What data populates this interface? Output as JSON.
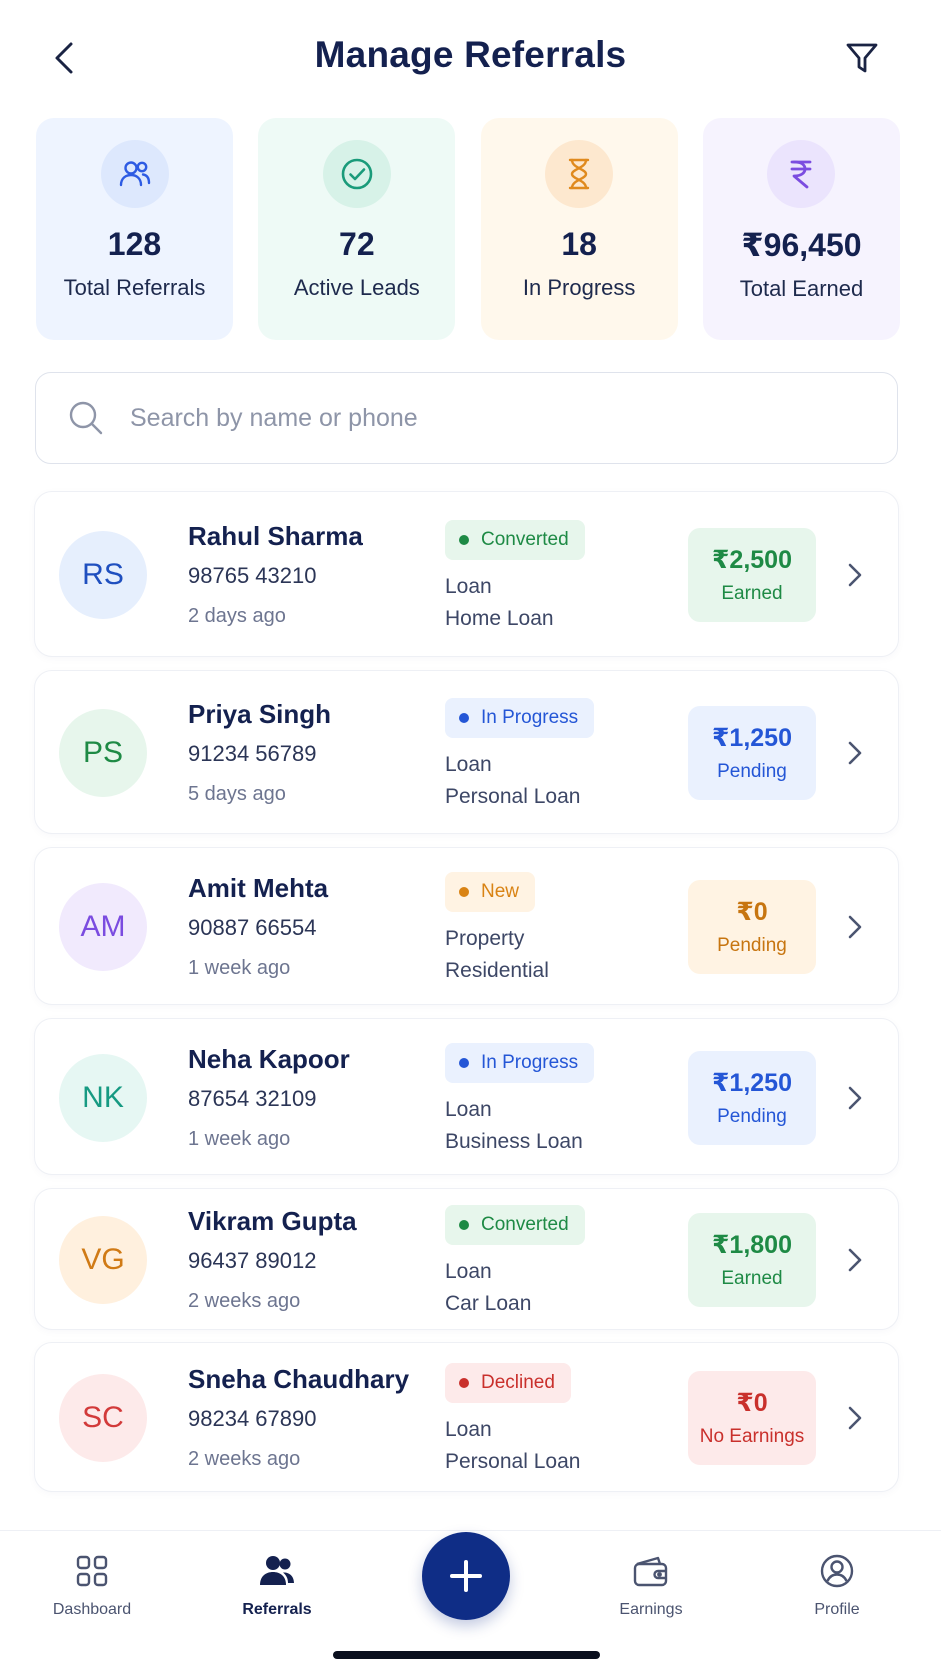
{
  "header": {
    "title": "Manage Referrals",
    "back_icon": "chevron-left-icon",
    "filter_icon": "filter-icon"
  },
  "stats": [
    {
      "value": "128",
      "label": "Total Referrals",
      "icon": "users-icon",
      "bg": "#eef4ff",
      "icon_bg": "#dde8fd",
      "icon_color": "#2d5be3"
    },
    {
      "value": "72",
      "label": "Active Leads",
      "icon": "check-circle-icon",
      "bg": "#eefaf6",
      "icon_bg": "#d7f2e8",
      "icon_color": "#1a9b7a"
    },
    {
      "value": "18",
      "label": "In Progress",
      "icon": "hourglass-icon",
      "bg": "#fff8ec",
      "icon_bg": "#fde8cf",
      "icon_color": "#e08a1e"
    },
    {
      "value": "₹96,450",
      "label": "Total Earned",
      "icon": "rupee-icon",
      "bg": "#f6f3fe",
      "icon_bg": "#ebe4fd",
      "icon_color": "#7b4ce0"
    }
  ],
  "search": {
    "placeholder": "Search by name or phone",
    "value": ""
  },
  "referrals": [
    {
      "initials": "RS",
      "name": "Rahul Sharma",
      "phone": "98765 43210",
      "time": "2 days ago",
      "status": "Converted",
      "category": "Loan",
      "subcategory": "Home Loan",
      "amount": "₹2,500",
      "amount_label": "Earned",
      "avatar_bg": "#e6effd",
      "avatar_fg": "#1f4fbf",
      "status_bg": "#e7f6ec",
      "status_fg": "#1e8a45",
      "earn_bg": "#e7f6ec",
      "earn_fg": "#1e8a45"
    },
    {
      "initials": "PS",
      "name": "Priya Singh",
      "phone": "91234 56789",
      "time": "5 days ago",
      "status": "In Progress",
      "category": "Loan",
      "subcategory": "Personal Loan",
      "amount": "₹1,250",
      "amount_label": "Pending",
      "avatar_bg": "#e7f6ec",
      "avatar_fg": "#1e8a45",
      "status_bg": "#eaf1fe",
      "status_fg": "#2456d6",
      "earn_bg": "#eaf1fe",
      "earn_fg": "#2456d6"
    },
    {
      "initials": "AM",
      "name": "Amit Mehta",
      "phone": "90887 66554",
      "time": "1 week ago",
      "status": "New",
      "category": "Property",
      "subcategory": "Residential",
      "amount": "₹0",
      "amount_label": "Pending",
      "avatar_bg": "#f1eafd",
      "avatar_fg": "#7b4ce0",
      "status_bg": "#fff3e3",
      "status_fg": "#d98314",
      "earn_bg": "#fff3e3",
      "earn_fg": "#c77510"
    },
    {
      "initials": "NK",
      "name": "Neha Kapoor",
      "phone": "87654 32109",
      "time": "1 week ago",
      "status": "In Progress",
      "category": "Loan",
      "subcategory": "Business Loan",
      "amount": "₹1,250",
      "amount_label": "Pending",
      "avatar_bg": "#e6f7f3",
      "avatar_fg": "#169a82",
      "status_bg": "#eaf1fe",
      "status_fg": "#2456d6",
      "earn_bg": "#eaf1fe",
      "earn_fg": "#2456d6"
    },
    {
      "initials": "VG",
      "name": "Vikram Gupta",
      "phone": "96437 89012",
      "time": "2 weeks ago",
      "status": "Converted",
      "category": "Loan",
      "subcategory": "Car Loan",
      "amount": "₹1,800",
      "amount_label": "Earned",
      "avatar_bg": "#fff0de",
      "avatar_fg": "#d07a15",
      "status_bg": "#e7f6ec",
      "status_fg": "#1e8a45",
      "earn_bg": "#e7f6ec",
      "earn_fg": "#1e8a45"
    },
    {
      "initials": "SC",
      "name": "Sneha Chaudhary",
      "phone": "98234 67890",
      "time": "2 weeks ago",
      "status": "Declined",
      "category": "Loan",
      "subcategory": "Personal Loan",
      "amount": "₹0",
      "amount_label": "No Earnings",
      "avatar_bg": "#fdeaea",
      "avatar_fg": "#d23a3a",
      "status_bg": "#fdeaea",
      "status_fg": "#c9302c",
      "earn_bg": "#fdeaea",
      "earn_fg": "#c9302c"
    }
  ],
  "tabbar": {
    "items": [
      {
        "label": "Dashboard",
        "icon": "grid-icon",
        "active": false
      },
      {
        "label": "Referrals",
        "icon": "users-icon",
        "active": true
      },
      {
        "label": "Earnings",
        "icon": "wallet-icon",
        "active": false
      },
      {
        "label": "Profile",
        "icon": "profile-icon",
        "active": false
      }
    ],
    "fab_icon": "plus-icon"
  }
}
